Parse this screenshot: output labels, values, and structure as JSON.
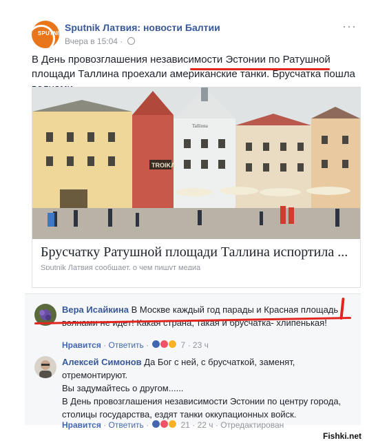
{
  "post": {
    "page_name": "Sputnik Латвия: новости Балтии",
    "timestamp": "Вчера в 15:04",
    "meta_separator": "·",
    "more_menu": "···",
    "avatar_text": "SPUTNIK",
    "text": "В День провозглашения независимости Эстонии по Ратушной площади Таллина проехали американские танки. Брусчатка пошла волнами.",
    "link_card": {
      "title": "Брусчатку Ратушной площади Таллина испортила ...",
      "desc": "Sputnik Латвия сообщает, о чем пишут медиа",
      "photo_sign": "TROIKA",
      "photo_house_sign": "Tallinna"
    }
  },
  "comments": [
    {
      "author": "Вера Исайкина",
      "text": "В Москве каждый год парады и Красная площадь волнами не идет! Какая страна, такая и брусчатка- хлипенькая!",
      "like_label": "Нравится",
      "reply_label": "Ответить",
      "reactions_count": "7",
      "time": "23 ч"
    },
    {
      "author": "Алексей Симонов",
      "lines": [
        "Да Бог с ней, с брусчаткой, заменят,",
        "отремонтируют.",
        "Вы задумайтесь о другом......",
        "В День провозглашения независимости Эстонии по центру города,",
        "столицы государства, ездят танки оккупационных войск."
      ],
      "like_label": "Нравится",
      "reply_label": "Ответить",
      "reactions_count": "21",
      "time": "22 ч",
      "edited": "Отредактирован"
    }
  ],
  "watermark": "Fishki.net",
  "colors": {
    "link_blue": "#385898",
    "action_blue": "#4267b2",
    "meta_gray": "#90949c",
    "annotation_red": "#e0261f",
    "sputnik_orange": "#e8751a"
  }
}
